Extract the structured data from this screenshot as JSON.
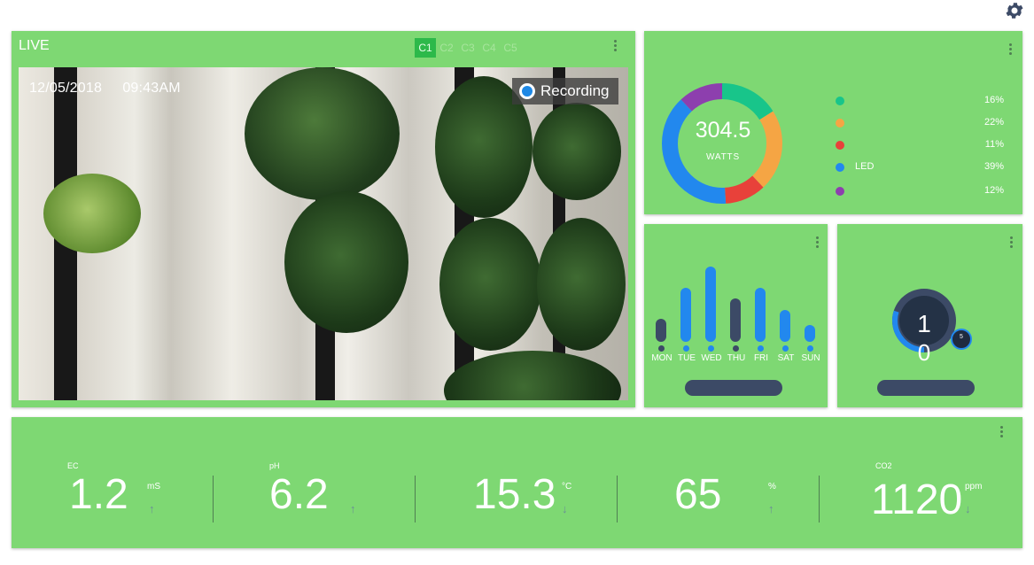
{
  "live": {
    "title": "LIVE",
    "cameras": [
      "C1",
      "C2",
      "C3",
      "C4",
      "C5"
    ],
    "active_camera": "C1",
    "date": "12/05/2018",
    "time": "09:43AM",
    "recording_label": "Recording"
  },
  "power": {
    "value": "304.5",
    "unit": "WATTS",
    "legend": [
      {
        "label": "",
        "percent": "16%",
        "color": "#18c58a",
        "share": 16
      },
      {
        "label": "",
        "percent": "22%",
        "color": "#f5a544",
        "share": 22
      },
      {
        "label": "",
        "percent": "11%",
        "color": "#e8413a",
        "share": 11
      },
      {
        "label": "LED",
        "percent": "39%",
        "color": "#2288ee",
        "share": 39
      },
      {
        "label": "",
        "percent": "12%",
        "color": "#8d3fae",
        "share": 12
      }
    ]
  },
  "weekly": {
    "days": [
      {
        "label": "MON",
        "level": 0.3,
        "color": "#3c4a66"
      },
      {
        "label": "TUE",
        "level": 0.72,
        "color": "#2288ee"
      },
      {
        "label": "WED",
        "level": 1.0,
        "color": "#2288ee"
      },
      {
        "label": "THU",
        "level": 0.58,
        "color": "#3c4a66"
      },
      {
        "label": "FRI",
        "level": 0.72,
        "color": "#2288ee"
      },
      {
        "label": "SAT",
        "level": 0.42,
        "color": "#2288ee"
      },
      {
        "label": "SUN",
        "level": 0.22,
        "color": "#2288ee"
      }
    ]
  },
  "gauge": {
    "line1": "1",
    "line2": "0",
    "badge": "5",
    "level": 0.3
  },
  "sensors": [
    {
      "label": "EC",
      "value": "1.2",
      "unit": "mS",
      "trend": "up"
    },
    {
      "label": "pH",
      "value": "6.2",
      "unit": "",
      "trend": "up"
    },
    {
      "label": "",
      "value": "15.3",
      "unit": "°C",
      "trend": "down"
    },
    {
      "label": "",
      "value": "65",
      "unit": "%",
      "trend": "up"
    },
    {
      "label": "CO2",
      "value": "1120",
      "unit": "ppm",
      "trend": "down"
    }
  ],
  "icons": {
    "settings": "gear-icon",
    "menu": "kebab-menu-icon",
    "trend_up": "arrow-up-icon",
    "trend_down": "arrow-down-icon"
  },
  "colors": {
    "panel": "#7ed873",
    "accent_blue": "#2288ee",
    "navy": "#3c4a66",
    "active_tab": "#2db94a"
  }
}
